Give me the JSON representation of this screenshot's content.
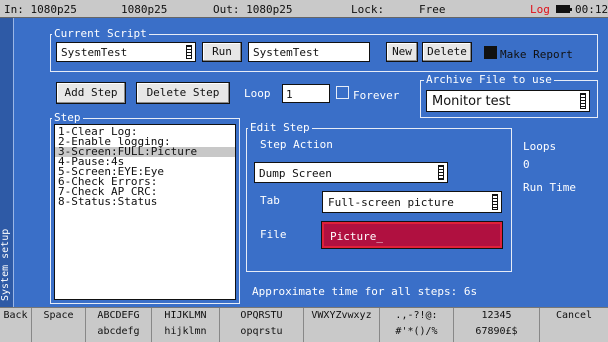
{
  "status": {
    "input": "In: 1080p25",
    "reference": "1080p25",
    "output": "Out: 1080p25",
    "lock_label": "Lock:",
    "lock_value": "Free",
    "log": "Log",
    "time": "00:12",
    "log_color": "#e0101a"
  },
  "sidebar": {
    "label": "System setup"
  },
  "current_script": {
    "group_label": "Current Script",
    "script_select": "SystemTest",
    "run_label": "Run",
    "name_value": "SystemTest",
    "new_label": "New",
    "delete_label": "Delete",
    "make_report_label": "Make Report",
    "make_report_checked": true
  },
  "actions": {
    "add_step": "Add Step",
    "delete_step": "Delete Step",
    "loop_label": "Loop",
    "loop_value": "1",
    "forever_label": "Forever",
    "forever_checked": false
  },
  "archive": {
    "group_label": "Archive File to use",
    "value": "Monitor test"
  },
  "steps": {
    "group_label": "Step",
    "items": [
      "1-Clear Log:",
      "2-Enable logging:",
      "3-Screen:FULL:Picture",
      "4-Pause:4s",
      "5-Screen:EYE:Eye",
      "6-Check Errors:",
      "7-Check AP CRC:",
      "8-Status:Status"
    ],
    "selected_index": 2
  },
  "edit_step": {
    "group_label": "Edit Step",
    "step_action_label": "Step Action",
    "action_value": "Dump Screen",
    "tab_label": "Tab",
    "tab_value": "Full-screen picture",
    "file_label": "File",
    "file_value": "Picture_",
    "file_border_color": "#e0203a",
    "file_bg_color": "#b01040"
  },
  "info": {
    "loops_label": "Loops",
    "loops_value": "0",
    "run_time_label": "Run Time",
    "approx_time": "Approximate time for all steps: 6s"
  },
  "keyboard": {
    "back": "Back",
    "space": "Space",
    "k1_top": "ABCDEFG",
    "k1_bottom": "abcdefg",
    "k2_top": "HIJKLMN",
    "k2_bottom": "hijklmn",
    "k3_top": "OPQRSTU",
    "k3_bottom": "opqrstu",
    "k4_top": "VWXYZvwxyz",
    "k4_bottom": "",
    "k5_top": ".,-?!@:",
    "k5_bottom": "#'*()/%",
    "k6_top": "12345",
    "k6_bottom": "67890£$",
    "cancel": "Cancel"
  }
}
